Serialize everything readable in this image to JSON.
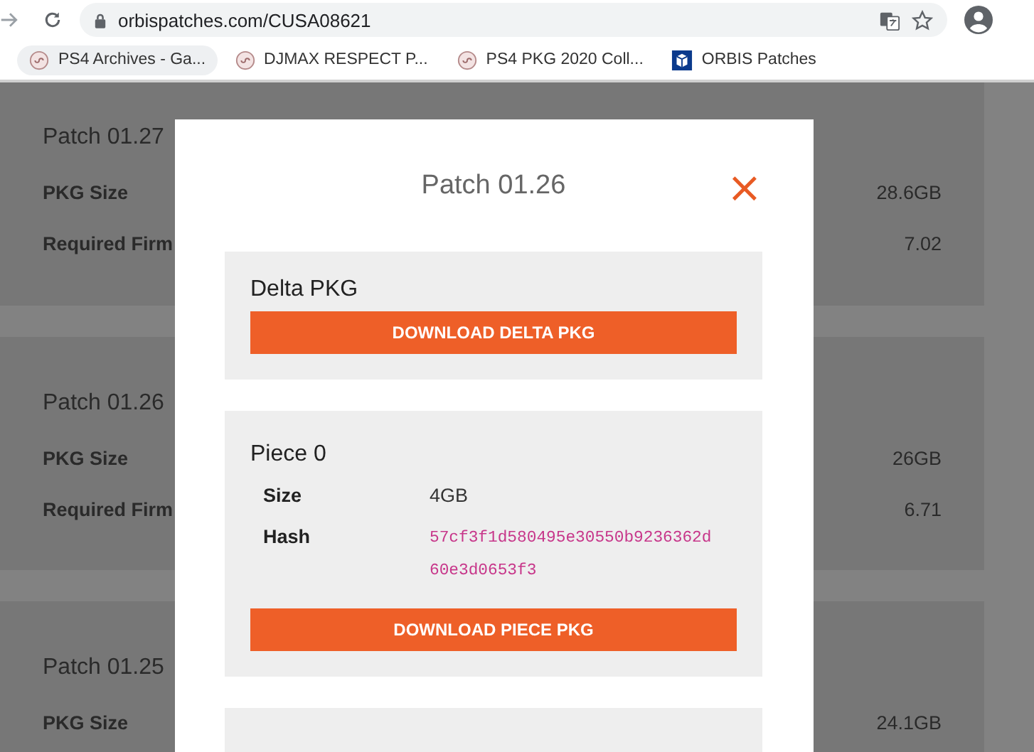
{
  "browser": {
    "url": "orbispatches.com/CUSA08621",
    "bookmarks": [
      {
        "label": "PS4 Archives - Ga...",
        "kind": "swirl",
        "selected": true
      },
      {
        "label": "DJMAX RESPECT P...",
        "kind": "swirl",
        "selected": false
      },
      {
        "label": "PS4 PKG 2020 Coll...",
        "kind": "swirl",
        "selected": false
      },
      {
        "label": "ORBIS Patches",
        "kind": "box",
        "selected": false
      }
    ]
  },
  "patches": [
    {
      "title": "Patch 01.27",
      "rows": [
        {
          "label": "PKG Size",
          "value": "28.6GB"
        },
        {
          "label": "Required Firm",
          "value": "7.02"
        }
      ]
    },
    {
      "title": "Patch 01.26",
      "rows": [
        {
          "label": "PKG Size",
          "value": "26GB"
        },
        {
          "label": "Required Firm",
          "value": "6.71"
        }
      ]
    },
    {
      "title": "Patch 01.25",
      "rows": [
        {
          "label": "PKG Size",
          "value": "24.1GB"
        }
      ]
    }
  ],
  "modal": {
    "title": "Patch 01.26",
    "close": "×",
    "sections": [
      {
        "kind": "delta",
        "title": "Delta PKG",
        "button": "DOWNLOAD DELTA PKG"
      },
      {
        "kind": "piece",
        "title": "Piece 0",
        "fields": [
          {
            "kind": "text",
            "label": "Size",
            "value": "4GB"
          },
          {
            "kind": "hash",
            "label": "Hash",
            "value": "57cf3f1d580495e30550b9236362d60e3d0653f3"
          }
        ],
        "button": "DOWNLOAD PIECE PKG"
      }
    ]
  }
}
